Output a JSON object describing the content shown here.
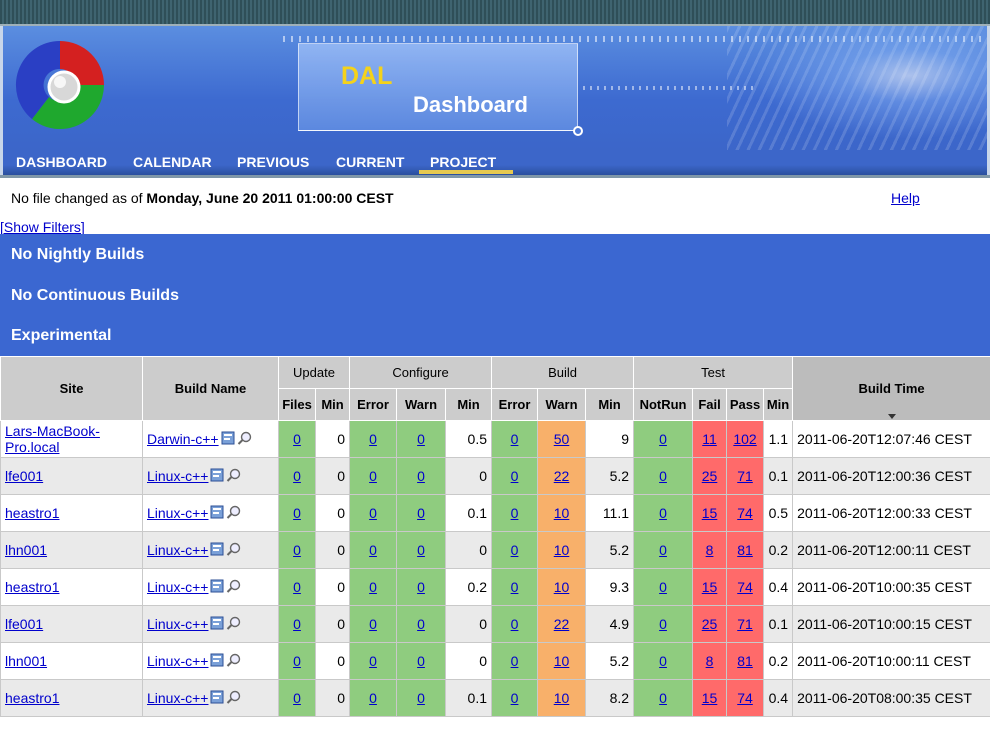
{
  "header": {
    "title_line1": "DAL",
    "title_line2": "Dashboard",
    "nav": [
      "DASHBOARD",
      "CALENDAR",
      "PREVIOUS",
      "CURRENT",
      "PROJECT"
    ],
    "active_nav": "PROJECT"
  },
  "info": {
    "prefix": "No file changed as of",
    "date": "Monday, June 20 2011 01:00:00 CEST",
    "help": "Help",
    "show_filters": "[Show Filters]"
  },
  "sections": [
    "No Nightly Builds",
    "No Continuous Builds",
    "Experimental"
  ],
  "table": {
    "groups": {
      "site": "Site",
      "build_name": "Build Name",
      "update": "Update",
      "configure": "Configure",
      "build": "Build",
      "test": "Test",
      "build_time": "Build Time"
    },
    "subheaders": {
      "update": [
        "Files",
        "Min"
      ],
      "configure": [
        "Error",
        "Warn",
        "Min"
      ],
      "build": [
        "Error",
        "Warn",
        "Min"
      ],
      "test": [
        "NotRun",
        "Fail",
        "Pass",
        "Min"
      ]
    },
    "rows": [
      {
        "site": "Lars-MacBook-Pro.local",
        "build": "Darwin-c++",
        "upd_files": "0",
        "upd_min": "0",
        "cfg_err": "0",
        "cfg_warn": "0",
        "cfg_min": "0.5",
        "bld_err": "0",
        "bld_warn": "50",
        "bld_min": "9",
        "notrun": "0",
        "fail": "11",
        "pass": "102",
        "test_min": "1.1",
        "time": "2011-06-20T12:07:46 CEST"
      },
      {
        "site": "lfe001",
        "build": "Linux-c++",
        "upd_files": "0",
        "upd_min": "0",
        "cfg_err": "0",
        "cfg_warn": "0",
        "cfg_min": "0",
        "bld_err": "0",
        "bld_warn": "22",
        "bld_min": "5.2",
        "notrun": "0",
        "fail": "25",
        "pass": "71",
        "test_min": "0.1",
        "time": "2011-06-20T12:00:36 CEST"
      },
      {
        "site": "heastro1",
        "build": "Linux-c++",
        "upd_files": "0",
        "upd_min": "0",
        "cfg_err": "0",
        "cfg_warn": "0",
        "cfg_min": "0.1",
        "bld_err": "0",
        "bld_warn": "10",
        "bld_min": "11.1",
        "notrun": "0",
        "fail": "15",
        "pass": "74",
        "test_min": "0.5",
        "time": "2011-06-20T12:00:33 CEST"
      },
      {
        "site": "lhn001",
        "build": "Linux-c++",
        "upd_files": "0",
        "upd_min": "0",
        "cfg_err": "0",
        "cfg_warn": "0",
        "cfg_min": "0",
        "bld_err": "0",
        "bld_warn": "10",
        "bld_min": "5.2",
        "notrun": "0",
        "fail": "8",
        "pass": "81",
        "test_min": "0.2",
        "time": "2011-06-20T12:00:11 CEST"
      },
      {
        "site": "heastro1",
        "build": "Linux-c++",
        "upd_files": "0",
        "upd_min": "0",
        "cfg_err": "0",
        "cfg_warn": "0",
        "cfg_min": "0.2",
        "bld_err": "0",
        "bld_warn": "10",
        "bld_min": "9.3",
        "notrun": "0",
        "fail": "15",
        "pass": "74",
        "test_min": "0.4",
        "time": "2011-06-20T10:00:35 CEST"
      },
      {
        "site": "lfe001",
        "build": "Linux-c++",
        "upd_files": "0",
        "upd_min": "0",
        "cfg_err": "0",
        "cfg_warn": "0",
        "cfg_min": "0",
        "bld_err": "0",
        "bld_warn": "22",
        "bld_min": "4.9",
        "notrun": "0",
        "fail": "25",
        "pass": "71",
        "test_min": "0.1",
        "time": "2011-06-20T10:00:15 CEST"
      },
      {
        "site": "lhn001",
        "build": "Linux-c++",
        "upd_files": "0",
        "upd_min": "0",
        "cfg_err": "0",
        "cfg_warn": "0",
        "cfg_min": "0",
        "bld_err": "0",
        "bld_warn": "10",
        "bld_min": "5.2",
        "notrun": "0",
        "fail": "8",
        "pass": "81",
        "test_min": "0.2",
        "time": "2011-06-20T10:00:11 CEST"
      },
      {
        "site": "heastro1",
        "build": "Linux-c++",
        "upd_files": "0",
        "upd_min": "0",
        "cfg_err": "0",
        "cfg_warn": "0",
        "cfg_min": "0.1",
        "bld_err": "0",
        "bld_warn": "10",
        "bld_min": "8.2",
        "notrun": "0",
        "fail": "15",
        "pass": "74",
        "test_min": "0.4",
        "time": "2011-06-20T08:00:35 CEST"
      }
    ]
  },
  "colors": {
    "section_blue": "#3b67d1",
    "pass_green": "#8fcc7f",
    "warn_orange": "#f8b06a",
    "fail_red": "#ff6a6a",
    "title_yellow": "#f4d21a"
  },
  "icons": [
    "cdash-logo-icon",
    "notes-icon",
    "magnifier-icon",
    "sort-down-arrow-icon"
  ]
}
